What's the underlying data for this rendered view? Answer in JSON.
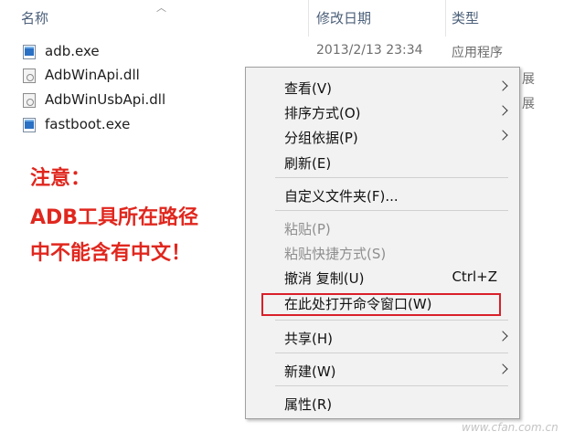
{
  "columns": {
    "name": "名称",
    "date": "修改日期",
    "type": "类型"
  },
  "files": [
    {
      "name": "adb.exe",
      "date": "2013/2/13 23:34",
      "type": "应用程序",
      "icon": "exe-file-icon"
    },
    {
      "name": "AdbWinApi.dll",
      "date": "",
      "type": "展",
      "icon": "dll-file-icon"
    },
    {
      "name": "AdbWinUsbApi.dll",
      "date": "",
      "type": "展",
      "icon": "dll-file-icon"
    },
    {
      "name": "fastboot.exe",
      "date": "",
      "type": "",
      "icon": "exe-file-icon"
    }
  ],
  "annotation": {
    "line1": "注意：",
    "line2": "ADB工具所在路径",
    "line3": "中不能含有中文！",
    "color": "#e0271e"
  },
  "context_menu": {
    "view": "查看(V)",
    "sort": "排序方式(O)",
    "group": "分组依据(P)",
    "refresh": "刷新(E)",
    "customize": "自定义文件夹(F)...",
    "paste": "粘贴(P)",
    "paste_shortcut": "粘贴快捷方式(S)",
    "undo_copy": "撤消 复制(U)",
    "undo_accel": "Ctrl+Z",
    "open_cmd": "在此处打开命令窗口(W)",
    "share": "共享(H)",
    "new": "新建(W)",
    "properties": "属性(R)"
  },
  "watermark": "www.cfan.com.cn"
}
